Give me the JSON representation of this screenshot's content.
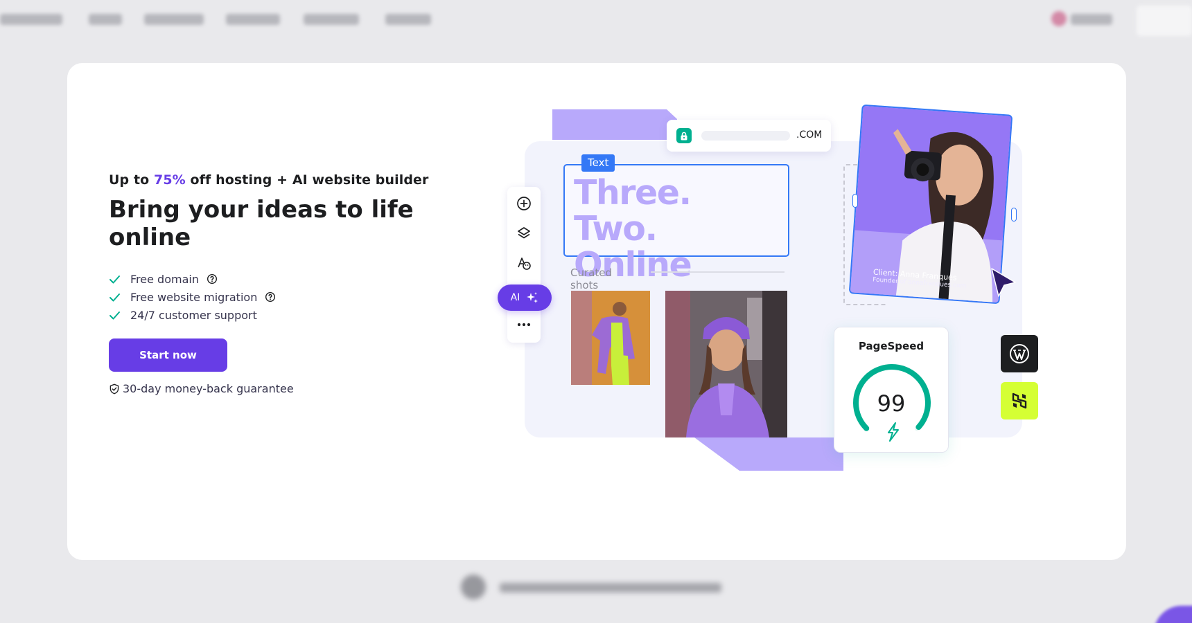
{
  "hero": {
    "promo_prefix": "Up to",
    "promo_percent": "75%",
    "promo_suffix": "off hosting + AI website builder",
    "headline": "Bring your ideas to life online",
    "features": [
      {
        "label": "Free domain",
        "icon": "check-icon",
        "help_icon": "question-circle-icon"
      },
      {
        "label": "Free website migration",
        "icon": "check-icon",
        "help_icon": "question-circle-icon"
      },
      {
        "label": "24/7 customer support",
        "icon": "check-icon"
      }
    ],
    "cta_label": "Start now",
    "guarantee": "30-day money-back guarantee"
  },
  "illustration": {
    "url_tld": ".COM",
    "text_tag": "Text",
    "text_content": "Three. Two. Online",
    "curated_label": "Curated shots",
    "ai_label": "AI",
    "photo_caption_name": "Client: Anna Franques",
    "photo_caption_role": "Founder of annafranques.com",
    "pagespeed_title": "PageSpeed",
    "pagespeed_score": "99",
    "pagespeed_fraction": 0.99
  },
  "colors": {
    "brand": "#673de6",
    "accent_green": "#00b090",
    "lavender": "#b8a9fb",
    "selection_blue": "#3478f6"
  }
}
